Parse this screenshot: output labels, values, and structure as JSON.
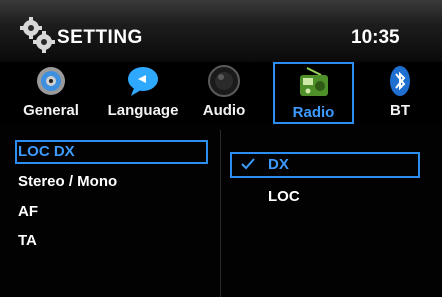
{
  "header": {
    "title": "SETTING",
    "time": "10:35"
  },
  "tabs": [
    {
      "label": "General",
      "icon": "disc-icon"
    },
    {
      "label": "Language",
      "icon": "speech-bubble-icon"
    },
    {
      "label": "Audio",
      "icon": "speaker-icon"
    },
    {
      "label": "Radio",
      "icon": "radio-icon",
      "active": true
    },
    {
      "label": "BT",
      "icon": "bluetooth-icon"
    }
  ],
  "left_menu": [
    {
      "label": "LOC DX",
      "selected": true
    },
    {
      "label": "Stereo / Mono"
    },
    {
      "label": "AF"
    },
    {
      "label": "TA"
    }
  ],
  "right_options": [
    {
      "label": "DX",
      "checked": true
    },
    {
      "label": "LOC"
    }
  ],
  "colors": {
    "accent": "#2e8df0",
    "active_text": "#3d9bff",
    "background": "#000000"
  }
}
